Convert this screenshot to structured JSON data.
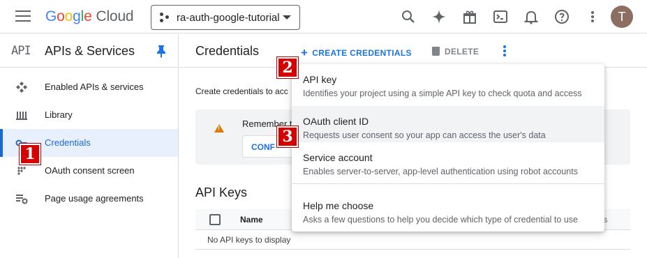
{
  "header": {
    "logo": {
      "g1": "G",
      "g2": "o",
      "g3": "o",
      "g4": "g",
      "g5": "l",
      "g6": "e",
      "cloud": "Cloud"
    },
    "project_name": "ra-auth-google-tutorial",
    "avatar_initial": "T",
    "icons": [
      "menu-icon",
      "search-icon",
      "gemini-sparkle-icon",
      "gift-icon",
      "cloud-shell-icon",
      "notifications-icon",
      "help-icon",
      "more-vert-icon"
    ]
  },
  "sidebar": {
    "api_badge": "API",
    "title": "APIs & Services",
    "items": [
      {
        "label": "Enabled APIs & services",
        "icon": "enabled-apis-icon"
      },
      {
        "label": "Library",
        "icon": "library-icon"
      },
      {
        "label": "Credentials",
        "icon": "credentials-key-icon",
        "active": true
      },
      {
        "label": "OAuth consent screen",
        "icon": "oauth-consent-icon"
      },
      {
        "label": "Page usage agreements",
        "icon": "page-usage-icon"
      }
    ]
  },
  "main": {
    "title": "Credentials",
    "create_label": "CREATE CREDENTIALS",
    "delete_label": "DELETE",
    "intro_text": "Create credentials to acc",
    "notice_text": "Remember t",
    "notice_button": "CONF",
    "api_keys_title": "API Keys",
    "table": {
      "name_header": "Name",
      "actions_header": "tions",
      "empty_text": "No API keys to display"
    }
  },
  "menu": {
    "items": [
      {
        "title": "API key",
        "desc": "Identifies your project using a simple API key to check quota and access"
      },
      {
        "title": "OAuth client ID",
        "desc": "Requests user consent so your app can access the user's data"
      },
      {
        "title": "Service account",
        "desc": "Enables server-to-server, app-level authentication using robot accounts"
      },
      {
        "title": "Help me choose",
        "desc": "Asks a few questions to help you decide which type of credential to use"
      }
    ]
  },
  "markers": [
    "1",
    "2",
    "3"
  ],
  "colors": {
    "accent": "#1a73e8",
    "active_bg": "#e8f0fe",
    "marker": "#d50000",
    "warning": "#e37400"
  }
}
